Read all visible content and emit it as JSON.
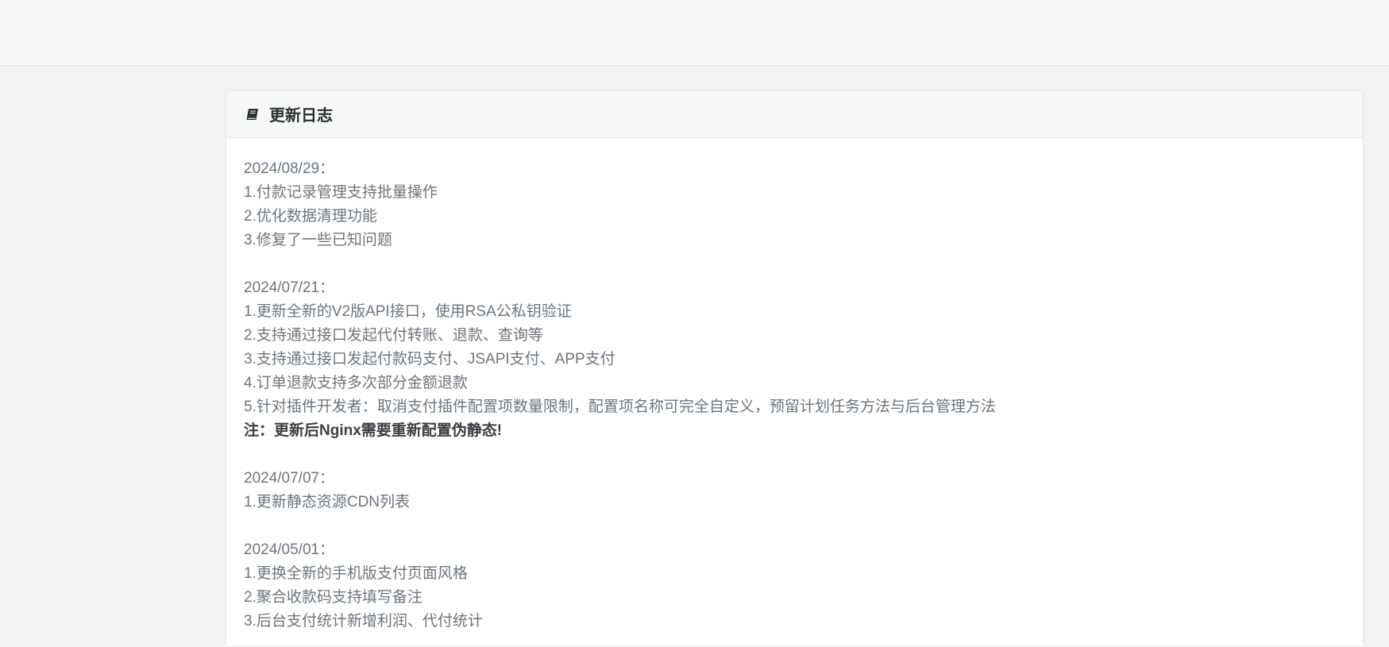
{
  "panel": {
    "title": "更新日志",
    "icon": "book-icon"
  },
  "entries": [
    {
      "date": "2024/08/29：",
      "items": [
        "1.付款记录管理支持批量操作",
        "2.优化数据清理功能",
        "3.修复了一些已知问题"
      ]
    },
    {
      "date": "2024/07/21：",
      "items": [
        "1.更新全新的V2版API接口，使用RSA公私钥验证",
        "2.支持通过接口发起代付转账、退款、查询等",
        "3.支持通过接口发起付款码支付、JSAPI支付、APP支付",
        "4.订单退款支持多次部分金额退款",
        "5.针对插件开发者：取消支付插件配置项数量限制，配置项名称可完全自定义，预留计划任务方法与后台管理方法"
      ],
      "note": "注：更新后Nginx需要重新配置伪静态!"
    },
    {
      "date": "2024/07/07：",
      "items": [
        "1.更新静态资源CDN列表"
      ]
    },
    {
      "date": "2024/05/01：",
      "items": [
        "1.更换全新的手机版支付页面风格",
        "2.聚合收款码支持填写备注",
        "3.后台支付统计新增利润、代付统计"
      ]
    }
  ]
}
